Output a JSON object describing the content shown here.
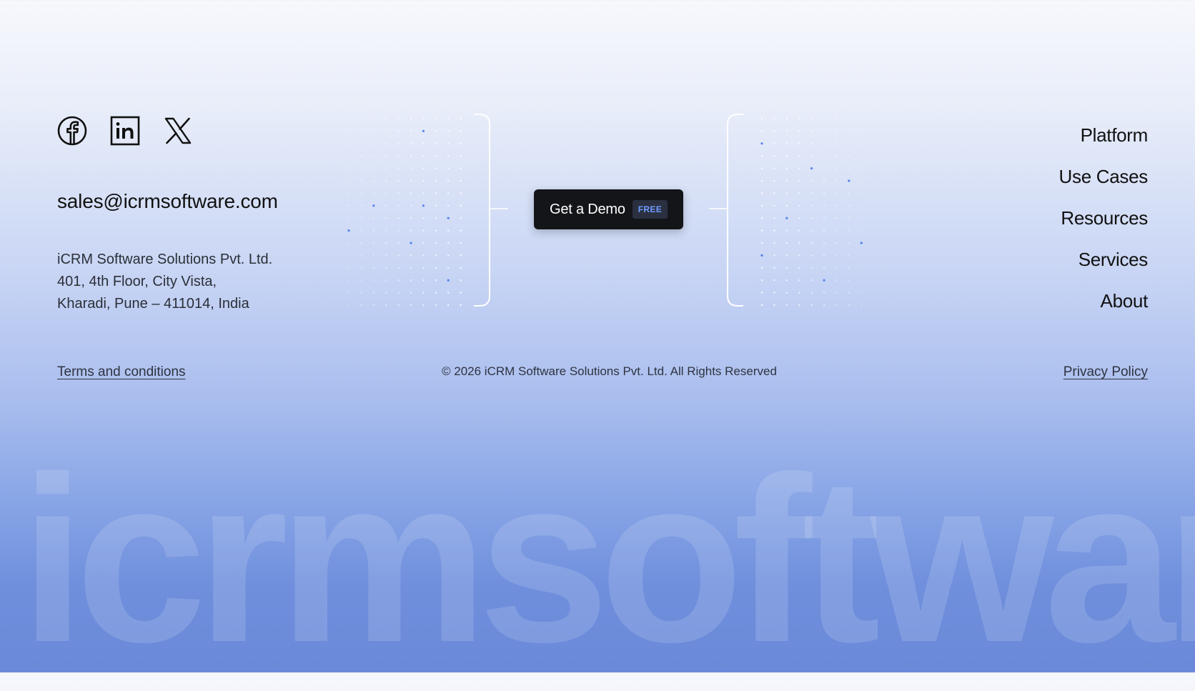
{
  "social": {
    "facebook_icon": "facebook-icon",
    "linkedin_icon": "linkedin-icon",
    "x_icon": "x-icon"
  },
  "contact": {
    "email": "sales@icrmsoftware.com",
    "address_lines": [
      "iCRM Software Solutions Pvt. Ltd.",
      "401, 4th Floor, City Vista,",
      "Kharadi, Pune – 411014, India"
    ]
  },
  "cta": {
    "label": "Get a Demo",
    "badge": "FREE"
  },
  "nav": {
    "items": [
      {
        "label": "Platform"
      },
      {
        "label": "Use Cases"
      },
      {
        "label": "Resources"
      },
      {
        "label": "Services"
      },
      {
        "label": "About"
      }
    ]
  },
  "footer": {
    "terms": "Terms and conditions",
    "copyright": "© 2026 iCRM Software Solutions Pvt. Ltd. All Rights Reserved",
    "privacy": "Privacy Policy"
  },
  "watermark": {
    "text": "icrmsoftware"
  },
  "colors": {
    "accent": "#6f9cff",
    "button_bg": "#141519",
    "dot_highlight": "#4f7ff0"
  }
}
